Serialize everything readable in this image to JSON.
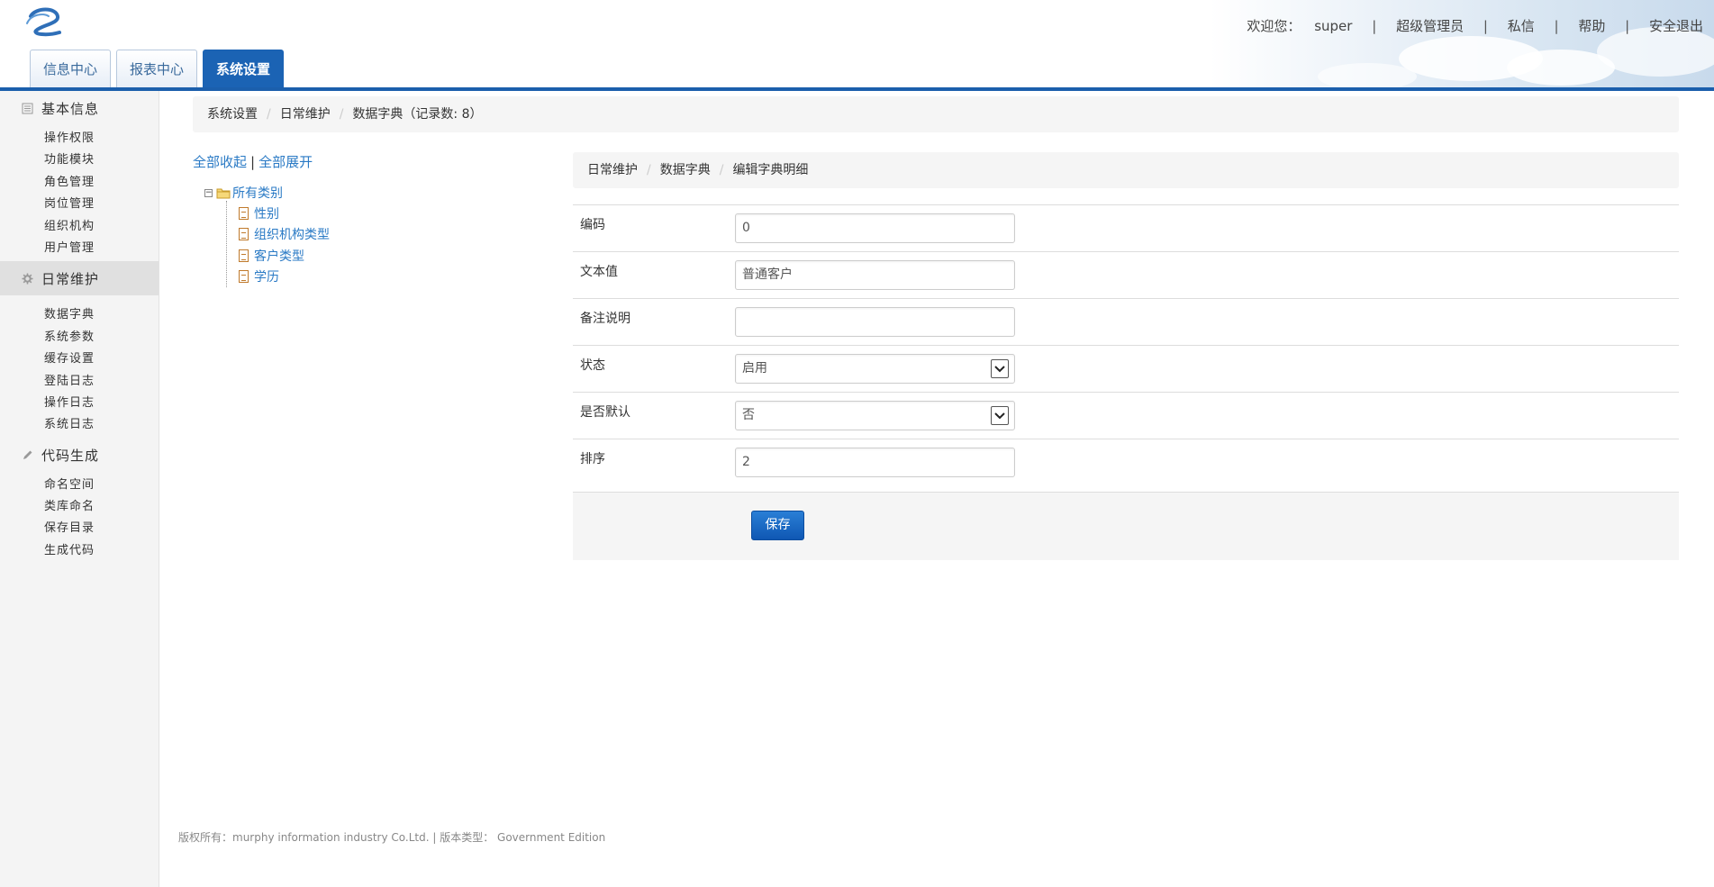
{
  "header": {
    "welcome": "欢迎您：",
    "username": "super",
    "role": "超级管理员",
    "links": [
      "私信",
      "帮助",
      "安全退出"
    ]
  },
  "tabs": [
    {
      "label": "信息中心",
      "active": false
    },
    {
      "label": "报表中心",
      "active": false
    },
    {
      "label": "系统设置",
      "active": true
    }
  ],
  "sidebar": {
    "groups": [
      {
        "title": "基本信息",
        "icon": "list-icon",
        "items": [
          "操作权限",
          "功能模块",
          "角色管理",
          "岗位管理",
          "组织机构",
          "用户管理"
        ]
      },
      {
        "title": "日常维护",
        "icon": "gear-icon",
        "active": true,
        "items": [
          "数据字典",
          "系统参数",
          "缓存设置",
          "登陆日志",
          "操作日志",
          "系统日志"
        ]
      },
      {
        "title": "代码生成",
        "icon": "pencil-icon",
        "items": [
          "命名空间",
          "类库命名",
          "保存目录",
          "生成代码"
        ]
      }
    ]
  },
  "breadcrumb": {
    "items": [
      "系统设置",
      "日常维护",
      "数据字典（记录数: 8）"
    ]
  },
  "tree": {
    "collapse_all": "全部收起",
    "separator": "|",
    "expand_all": "全部展开",
    "root": "所有类别",
    "children": [
      "性别",
      "组织机构类型",
      "客户类型",
      "学历"
    ]
  },
  "panel": {
    "breadcrumb": [
      "日常维护",
      "数据字典",
      "编辑字典明细"
    ],
    "fields": {
      "code": {
        "label": "编码",
        "value": "0"
      },
      "text": {
        "label": "文本值",
        "value": "普通客户"
      },
      "remark": {
        "label": "备注说明",
        "value": ""
      },
      "status": {
        "label": "状态",
        "value": "启用"
      },
      "is_default": {
        "label": "是否默认",
        "value": "否"
      },
      "sort": {
        "label": "排序",
        "value": "2"
      }
    },
    "save_label": "保存"
  },
  "footer": {
    "copyright": "版权所有：murphy information industry Co.Ltd. | 版本类型： Government Edition"
  },
  "colors": {
    "accent": "#1b63b4",
    "link": "#2a7ac5"
  }
}
